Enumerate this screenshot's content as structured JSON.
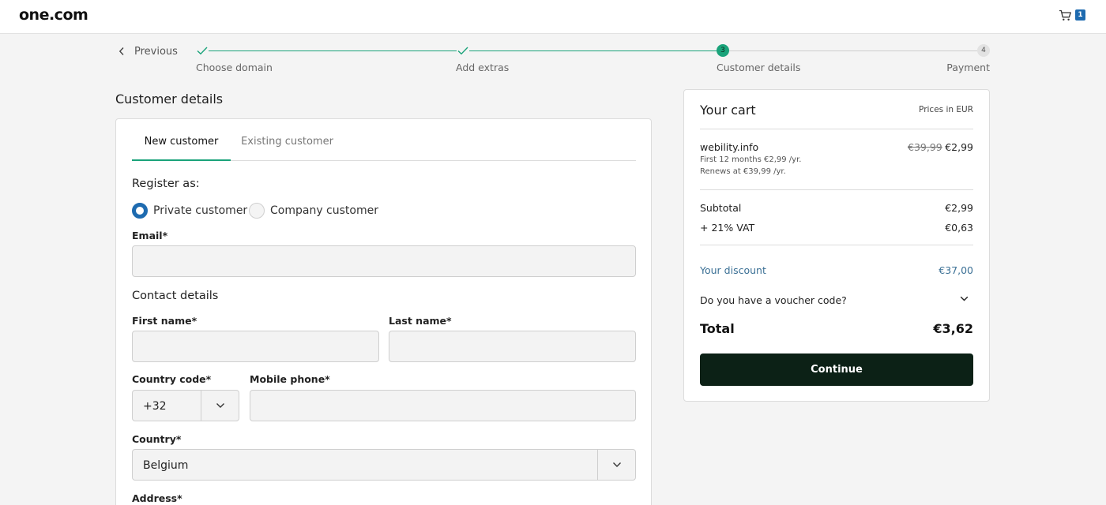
{
  "header": {
    "logo": "one.com",
    "cart_count": "1"
  },
  "stepper": {
    "previous_label": "Previous",
    "steps": [
      {
        "label": "Choose domain",
        "status": "done"
      },
      {
        "label": "Add extras",
        "status": "done"
      },
      {
        "label": "Customer details",
        "status": "current",
        "number": "3"
      },
      {
        "label": "Payment",
        "status": "upcoming",
        "number": "4"
      }
    ]
  },
  "form": {
    "title": "Customer details",
    "tabs": [
      {
        "label": "New customer",
        "active": true
      },
      {
        "label": "Existing customer",
        "active": false
      }
    ],
    "register_as_label": "Register as:",
    "register_options": [
      {
        "label": "Private customer",
        "selected": true
      },
      {
        "label": "Company customer",
        "selected": false
      }
    ],
    "email_label": "Email*",
    "email_value": "",
    "contact_heading": "Contact details",
    "first_name_label": "First name*",
    "first_name_value": "",
    "last_name_label": "Last name*",
    "last_name_value": "",
    "country_code_label": "Country code*",
    "country_code_value": "+32",
    "mobile_label": "Mobile phone*",
    "mobile_value": "",
    "country_label": "Country*",
    "country_value": "Belgium",
    "address_label": "Address*"
  },
  "cart": {
    "title": "Your cart",
    "prices_in": "Prices in EUR",
    "item": {
      "name": "webility.info",
      "old_price": "€39,99",
      "price": "€2,99",
      "line1": "First 12 months €2,99 /yr.",
      "line2": "Renews at €39,99 /yr."
    },
    "subtotal_label": "Subtotal",
    "subtotal_value": "€2,99",
    "vat_label": "+ 21% VAT",
    "vat_value": "€0,63",
    "discount_label": "Your discount",
    "discount_value": "€37,00",
    "voucher_label": "Do you have a voucher code?",
    "total_label": "Total",
    "total_value": "€3,62",
    "continue_label": "Continue"
  },
  "colors": {
    "accent_green": "#1aa37a",
    "primary_blue": "#1e6bb0",
    "discount_blue": "#3b7095",
    "button_dark": "#0c2116"
  }
}
